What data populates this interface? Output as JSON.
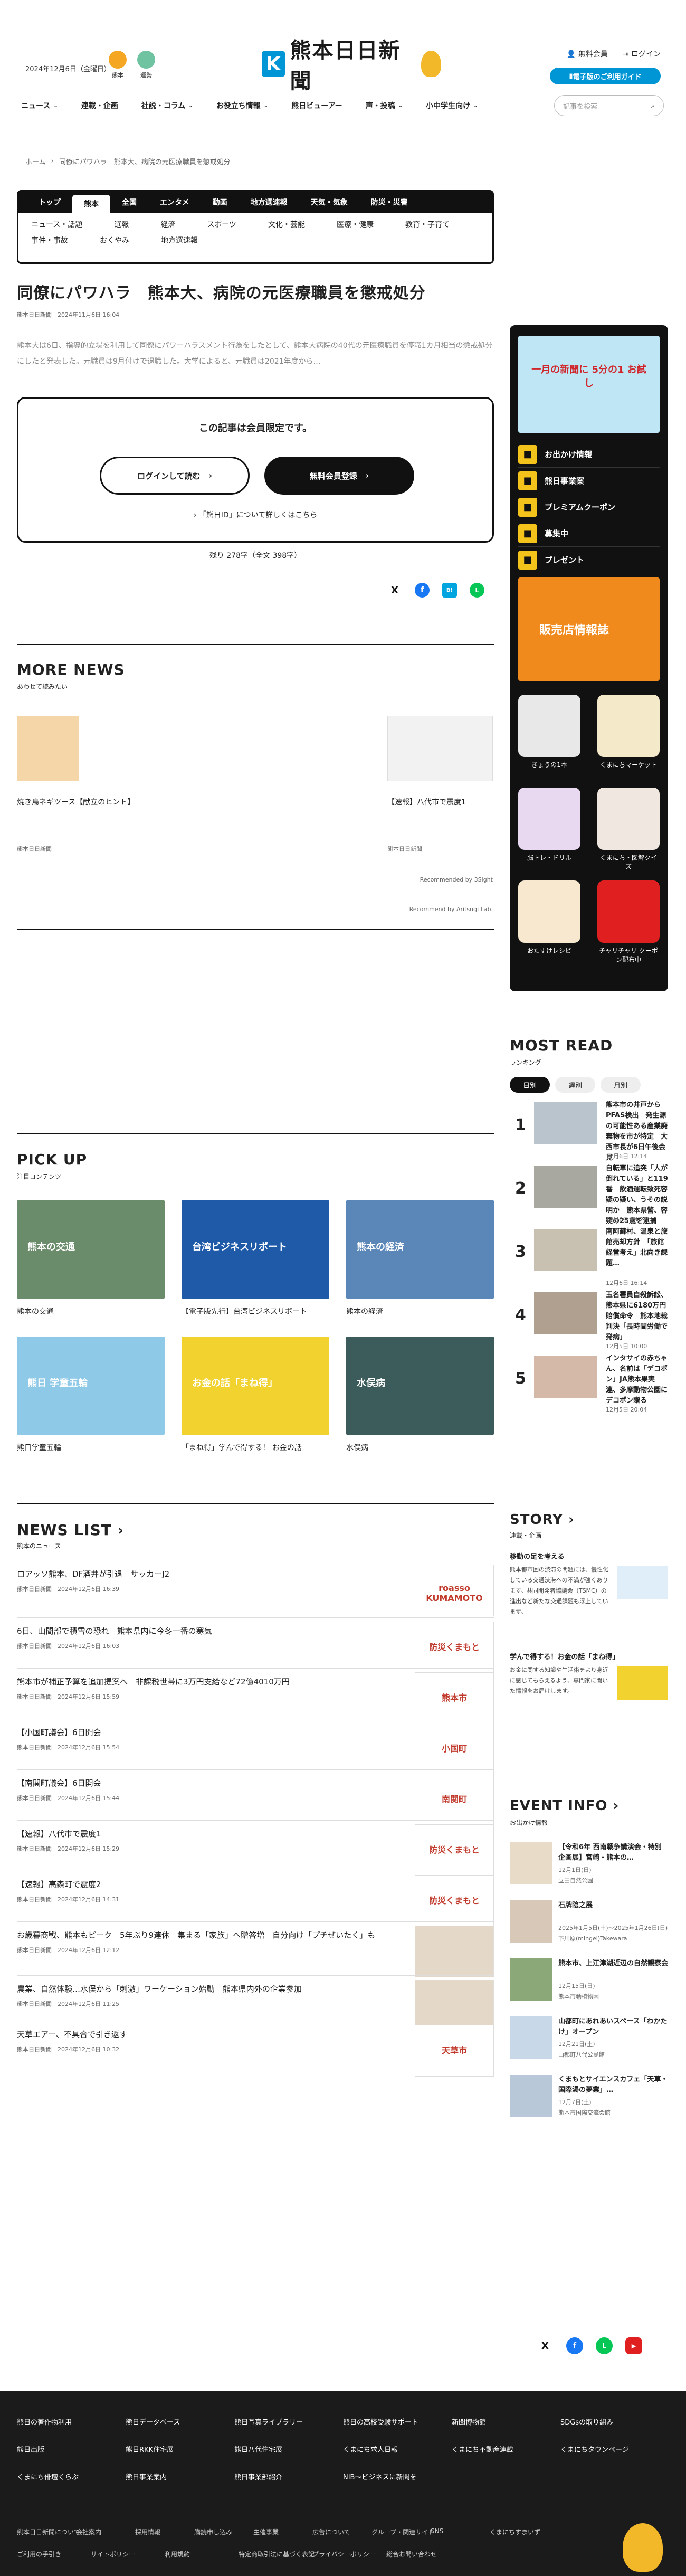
{
  "header": {
    "date": "2024年12月6日（金曜日）",
    "weather": [
      {
        "label": "熊本",
        "color": "#f5a623"
      },
      {
        "label": "運勢",
        "color": "#6fc3a0"
      }
    ],
    "logo_text": "熊本日日新聞",
    "logo_k": "K",
    "links": [
      "無料会員",
      "ログイン"
    ],
    "denshi": "電子版のご利用ガイド"
  },
  "nav": {
    "items": [
      {
        "label": "ニュース",
        "chev": "⌄"
      },
      {
        "label": "連載・企画",
        "chev": ""
      },
      {
        "label": "社説・コラム",
        "chev": "⌄"
      },
      {
        "label": "お役立ち情報",
        "chev": "⌄"
      },
      {
        "label": "熊日ビューアー",
        "chev": ""
      },
      {
        "label": "声・投稿",
        "chev": "⌄"
      },
      {
        "label": "小中学生向け",
        "chev": "⌄"
      }
    ],
    "search_placeholder": "記事を検索"
  },
  "breadcrumb": {
    "home": "ホーム",
    "current": "同僚にパワハラ　熊本大、病院の元医療職員を懲戒処分"
  },
  "categories": {
    "tabs": [
      "トップ",
      "熊本",
      "全国",
      "エンタメ",
      "動画",
      "地方選速報",
      "天気・気象",
      "防災・災害"
    ],
    "active": 1,
    "subs": [
      "ニュース・話題",
      "選報",
      "経済",
      "スポーツ",
      "文化・芸能",
      "医療・健康",
      "教育・子育て",
      "事件・事故",
      "おくやみ",
      "地方選速報"
    ]
  },
  "article": {
    "title": "同僚にパワハラ　熊本大、病院の元医療職員を懲戒処分",
    "byline": "熊本日日新聞　2024年11月6日 16:04",
    "lead": "熊本大は6日、指導的立場を利用して同僚にパワーハラスメント行為をしたとして、熊本大病院の40代の元医療職員を停職1カ月相当の懲戒処分にしたと発表した。元職員は9月付けで退職した。大学によると、元職員は2021年度から…",
    "member_head": "この記事は会員限定です。",
    "login_btn": "ログインして読む",
    "register_btn": "無料会員登録",
    "about_link": "「熊日ID」について詳しくはこちら",
    "remain": "残り 278字（全文 398字）"
  },
  "share": {
    "x": "X",
    "fb": "f",
    "hb": "B!",
    "line": "L"
  },
  "more_news": {
    "title": "MORE NEWS",
    "sub": "あわせて読みたい",
    "items": [
      {
        "title": "焼き鳥ネギツース【献立のヒント】",
        "source": "熊本日日新聞"
      },
      {
        "title": "【速報】八代市で震度1",
        "source": "熊本日日新聞"
      }
    ],
    "rec1": "Recommended by 3Sight",
    "rec2": "Recommend by Aritsugi Lab."
  },
  "pick_up": {
    "title": "PICK UP",
    "sub": "注目コンテンツ",
    "items": [
      {
        "title": "熊本の交通",
        "img_label": "熊本の交通",
        "color": "#6b8c6a"
      },
      {
        "title": "【電子版先行】台湾ビジネスリポート",
        "img_label": "台湾ビジネスリポート",
        "color": "#1e5aa8"
      },
      {
        "title": "熊本の経済",
        "img_label": "熊本の経済",
        "color": "#5a86b8"
      },
      {
        "title": "熊日学童五輪",
        "img_label": "熊日 学童五輪",
        "color": "#8ec9e8"
      },
      {
        "title": "「まね得」学んで得する！ お金の話",
        "img_label": "お金の話「まね得」",
        "color": "#f2d22e"
      },
      {
        "title": "水俣病",
        "img_label": "水俣病",
        "color": "#3b5c5a"
      }
    ]
  },
  "news_list": {
    "title": "NEWS LIST",
    "sub": "熊本のニュース",
    "items": [
      {
        "title": "ロアッソ熊本、DF酒井が引退　サッカーJ2",
        "date": "熊本日日新聞　2024年12月6日 16:39",
        "img": "roasso KUMAMOTO"
      },
      {
        "title": "6日、山間部で積雪の恐れ　熊本県内に今冬一番の寒気",
        "date": "熊本日日新聞　2024年12月6日 16:03",
        "img": "防災くまもと"
      },
      {
        "title": "熊本市が補正予算を追加提案へ　非課税世帯に3万円支給など72億4010万円",
        "date": "熊本日日新聞　2024年12月6日 15:59",
        "img": "熊本市"
      },
      {
        "title": "【小国町議会】6日開会",
        "date": "熊本日日新聞　2024年12月6日 15:54",
        "img": "小国町"
      },
      {
        "title": "【南関町議会】6日開会",
        "date": "熊本日日新聞　2024年12月6日 15:44",
        "img": "南関町"
      },
      {
        "title": "【速報】八代市で震度1",
        "date": "熊本日日新聞　2024年12月6日 15:29",
        "img": "防災くまもと"
      },
      {
        "title": "【速報】高森町で震度2",
        "date": "熊本日日新聞　2024年12月6日 14:31",
        "img": "防災くまもと"
      },
      {
        "title": "お歳暮商戦、熊本もピーク　5年ぶり9連休　集まる「家族」へ贈答増　自分向け「プチぜいたく」も",
        "date": "熊本日日新聞　2024年12月6日 12:12",
        "img": ""
      },
      {
        "title": "農業、自然体験…水俣から「刺激」ワーケーション始動　熊本県内外の企業参加",
        "date": "熊本日日新聞　2024年12月6日 11:25",
        "img": ""
      },
      {
        "title": "天草エアー、不具合で引き返す",
        "date": "熊本日日新聞　2024年12月6日 10:32",
        "img": "天草市"
      }
    ]
  },
  "sidebar": {
    "banner_text": "一月の新聞に 5分の1 お試し",
    "menu": [
      "お出かけ情報",
      "熊日事業案",
      "プレミアムクーポン",
      "募集中",
      "プレゼント"
    ],
    "banner2": "販売店情報誌",
    "apps": [
      {
        "label": "きょうの1本",
        "color": "#e8e8e8"
      },
      {
        "label": "くまにちマーケット",
        "color": "#f4e9c8"
      },
      {
        "label": "脳トレ・ドリル",
        "color": "#e8d8f0"
      },
      {
        "label": "くまにち・図解クイズ",
        "color": "#f0e8e0"
      },
      {
        "label": "おたすけレシピ",
        "color": "#f8e8d0"
      },
      {
        "label": "チャリチャリ クーポン配布中",
        "color": "#e02020"
      }
    ]
  },
  "most_read": {
    "title": "MOST READ",
    "sub": "ランキング",
    "tabs": [
      "日別",
      "週別",
      "月別"
    ],
    "items": [
      {
        "n": "1",
        "title": "熊本市の井戸からPFAS検出　発生源の可能性ある産業廃棄物を市が特定　大西市長が6日午後会見",
        "date": "12月6日 12:14"
      },
      {
        "n": "2",
        "title": "自転車に追突「人が倒れている」と119番　飲酒運転致死容疑の疑い、うその説明か　熊本県警、容疑の25歳を逮捕",
        "date": "12月6日 14:22"
      },
      {
        "n": "3",
        "title": "南阿蘇村、温泉と旅館売却方針　「旅館経営考え」北向き課題…",
        "date": "12月6日 16:14"
      },
      {
        "n": "4",
        "title": "玉名署員自殺訴訟、熊本県に6180万円賠償命令　熊本地裁判決「長時間労働で発病」",
        "date": "12月5日 10:00"
      },
      {
        "n": "5",
        "title": "インタサイの赤ちゃん、名前は「デコポン」JA熊本果実連、多摩動物公園にデコポン贈る",
        "date": "12月5日 20:04"
      }
    ]
  },
  "story": {
    "title": "STORY",
    "sub": "連載・企画",
    "items": [
      {
        "title": "移動の足を考える",
        "body": "熊本都市圏の渋滞の問題には、慢性化している交通渋滞への不満が強くあります。共同開発者協議会（TSMC）の進出など新たな交通課題も浮上しています。"
      },
      {
        "title": "学んで得する！お金の話「まね得」",
        "body": "お金に関する知識や生活術をより身近に感じてもらえるよう、専門家に聞いた情報をお届けします。"
      }
    ]
  },
  "event_info": {
    "title": "EVENT INFO",
    "sub": "お出かけ情報",
    "items": [
      {
        "title": "【令和6年 西南戦争講演会・特別企画展】宮崎・熊本の…",
        "d1": "12月1日(日)",
        "d2": "立田自然公園"
      },
      {
        "title": "石牌陰之展",
        "d1": "2025年1月5日(土)～2025年1月26日(日)",
        "d2": "下川原(mingei)Takewara"
      },
      {
        "title": "熊本市、上江津湖近辺の自然観察会",
        "d1": "12月15日(日)",
        "d2": "熊本市動植物園"
      },
      {
        "title": "山都町にあれあいスペース「わかたけ」オープン",
        "d1": "12月21日(土)",
        "d2": "山都町八代公民館"
      },
      {
        "title": "くまもとサイエンスカフェ「天草・国際湯の夢業」…",
        "d1": "12月7日(土)",
        "d2": "熊本市国際交流会館"
      }
    ]
  },
  "footer": {
    "social": [
      "X",
      "f",
      "L",
      "▶"
    ],
    "links": [
      "熊日の著作物利用",
      "熊日データベース",
      "熊日写真ライブラリー",
      "熊日の高校受験サポート",
      "新聞博物館",
      "SDGsの取り組み",
      "熊日出版",
      "熊日RKK住宅展",
      "熊日八代住宅展",
      "くまにち求人日報",
      "くまにち不動産連載",
      "くまにちタウンページ",
      "くまにち俳壇くらぶ",
      "熊日事業案内",
      "熊日事業部紹介",
      "NIB～ビジネスに新聞を"
    ],
    "bottom1": [
      "熊本日日新聞について",
      "会社案内",
      "採用情報",
      "購読申し込み",
      "主催事業",
      "広告について",
      "グループ・関連サイト",
      "SNS",
      "くまにちすまいず"
    ],
    "bottom2": [
      "ご利用の手引き",
      "サイトポリシー",
      "利用規約",
      "特定商取引法に基づく表記",
      "プライバシーポリシー",
      "総合お問い合わせ"
    ]
  }
}
